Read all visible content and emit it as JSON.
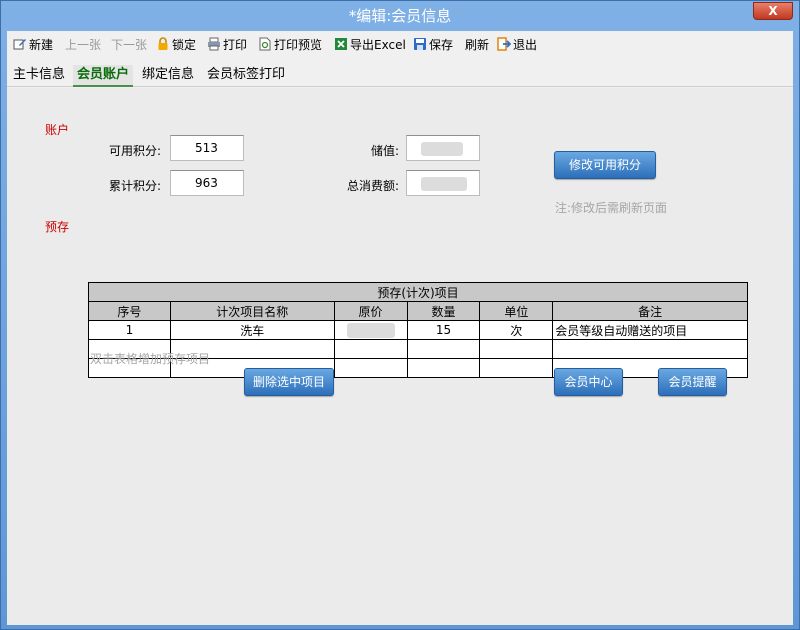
{
  "window": {
    "title": "*编辑:会员信息",
    "close_label": "X"
  },
  "toolbar": {
    "new": "新建",
    "prev": "上一张",
    "next": "下一张",
    "lock": "锁定",
    "print": "打印",
    "print_preview": "打印预览",
    "export_excel": "导出Excel",
    "save": "保存",
    "refresh": "刷新",
    "exit": "退出"
  },
  "tabs": [
    {
      "label": "主卡信息"
    },
    {
      "label": "会员账户"
    },
    {
      "label": "绑定信息"
    },
    {
      "label": "会员标签打印"
    }
  ],
  "account": {
    "section_label": "账户",
    "available_points_label": "可用积分:",
    "available_points": "513",
    "total_points_label": "累计积分:",
    "total_points": "963",
    "stored_value_label": "储值:",
    "total_spend_label": "总消费额:",
    "modify_points_button": "修改可用积分",
    "note": "注:修改后需刷新页面"
  },
  "prepaid": {
    "section_label": "预存",
    "table_caption": "预存(计次)项目",
    "columns": [
      "序号",
      "计次项目名称",
      "原价",
      "数量",
      "单位",
      "备注"
    ],
    "rows": [
      {
        "no": "1",
        "name": "洗车",
        "price": "",
        "qty": "15",
        "unit": "次",
        "remark": "会员等级自动赠送的项目"
      }
    ],
    "hint": "双击表格增加预存项目",
    "delete_button": "删除选中项目",
    "member_center_button": "会员中心",
    "member_remind_button": "会员提醒"
  },
  "colors": {
    "section_label": "#cc0000",
    "active_tab": "#0a6b0a",
    "button_blue": "#2c6fba"
  }
}
